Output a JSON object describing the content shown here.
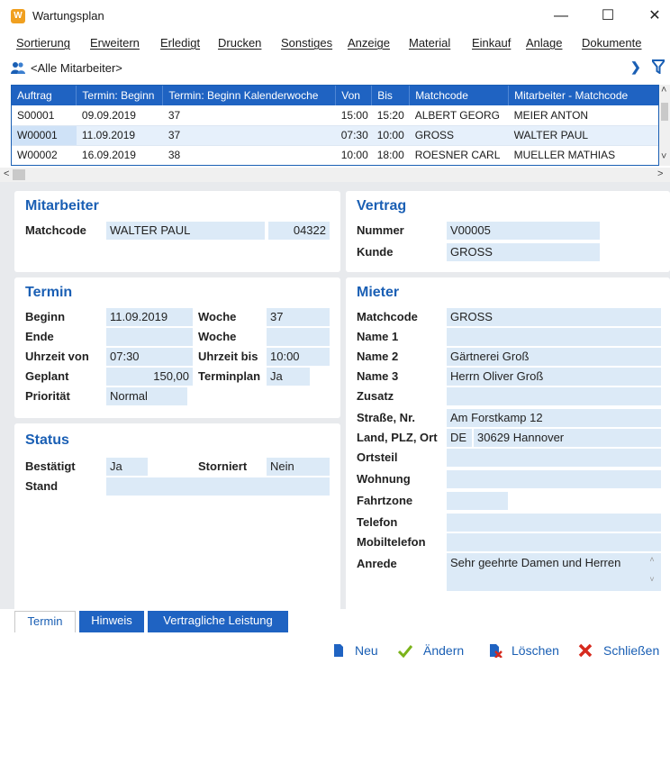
{
  "window": {
    "title": "Wartungsplan"
  },
  "menu": [
    "Sortierung",
    "Erweitern",
    "Erledigt",
    "Drucken",
    "Sonstiges",
    "Anzeige",
    "Material",
    "Einkauf",
    "Anlage",
    "Dokumente"
  ],
  "filter": {
    "label": "<Alle Mitarbeiter>"
  },
  "grid": {
    "columns": [
      "Auftrag",
      "Termin: Beginn",
      "Termin: Beginn Kalenderwoche",
      "Von",
      "Bis",
      "Matchcode",
      "Mitarbeiter - Matchcode"
    ],
    "rows": [
      [
        "S00001",
        "09.09.2019",
        "37",
        "15:00",
        "15:20",
        "ALBERT GEORG",
        "MEIER ANTON"
      ],
      [
        "W00001",
        "11.09.2019",
        "37",
        "07:30",
        "10:00",
        "GROSS",
        "WALTER PAUL"
      ],
      [
        "W00002",
        "16.09.2019",
        "38",
        "10:00",
        "18:00",
        "ROESNER CARL",
        "MUELLER MATHIAS"
      ]
    ]
  },
  "mitarbeiter": {
    "title": "Mitarbeiter",
    "matchcode_label": "Matchcode",
    "matchcode": "WALTER PAUL",
    "number": "04322"
  },
  "vertrag": {
    "title": "Vertrag",
    "nummer_label": "Nummer",
    "nummer": "V00005",
    "kunde_label": "Kunde",
    "kunde": "GROSS"
  },
  "termin": {
    "title": "Termin",
    "beginn_label": "Beginn",
    "beginn": "11.09.2019",
    "woche_label": "Woche",
    "woche": "37",
    "ende_label": "Ende",
    "ende": "",
    "woche2_label": "Woche",
    "woche2": "",
    "uhrzeit_von_label": "Uhrzeit von",
    "uhrzeit_von": "07:30",
    "uhrzeit_bis_label": "Uhrzeit bis",
    "uhrzeit_bis": "10:00",
    "geplant_label": "Geplant",
    "geplant": "150,00",
    "terminplan_label": "Terminplan",
    "terminplan": "Ja",
    "prioritaet_label": "Priorität",
    "prioritaet": "Normal"
  },
  "status": {
    "title": "Status",
    "bestaetigt_label": "Bestätigt",
    "bestaetigt": "Ja",
    "storniert_label": "Storniert",
    "storniert": "Nein",
    "stand_label": "Stand",
    "stand": ""
  },
  "mieter": {
    "title": "Mieter",
    "matchcode_label": "Matchcode",
    "matchcode": "GROSS",
    "name1_label": "Name 1",
    "name1": "",
    "name2_label": "Name 2",
    "name2": "Gärtnerei Groß",
    "name3_label": "Name 3",
    "name3": "Herrn Oliver Groß",
    "zusatz_label": "Zusatz",
    "zusatz": "",
    "strasse_label": "Straße, Nr.",
    "strasse": "Am Forstkamp 12",
    "land_label": "Land, PLZ, Ort",
    "land": "DE",
    "plz_ort": "30629 Hannover",
    "ortsteil_label": "Ortsteil",
    "ortsteil": "",
    "wohnung_label": "Wohnung",
    "wohnung": "",
    "fahrtzone_label": "Fahrtzone",
    "fahrtzone": "",
    "telefon_label": "Telefon",
    "telefon": "",
    "mobiltelefon_label": "Mobiltelefon",
    "mobiltelefon": "",
    "anrede_label": "Anrede",
    "anrede": "Sehr geehrte Damen und Herren"
  },
  "tabs": [
    "Termin",
    "Hinweis",
    "Vertragliche Leistung"
  ],
  "actions": {
    "neu": "Neu",
    "aendern": "Ändern",
    "loeschen": "Löschen",
    "schliessen": "Schließen"
  },
  "colors": {
    "accent": "#1f63c2",
    "field": "#dceaf7"
  }
}
